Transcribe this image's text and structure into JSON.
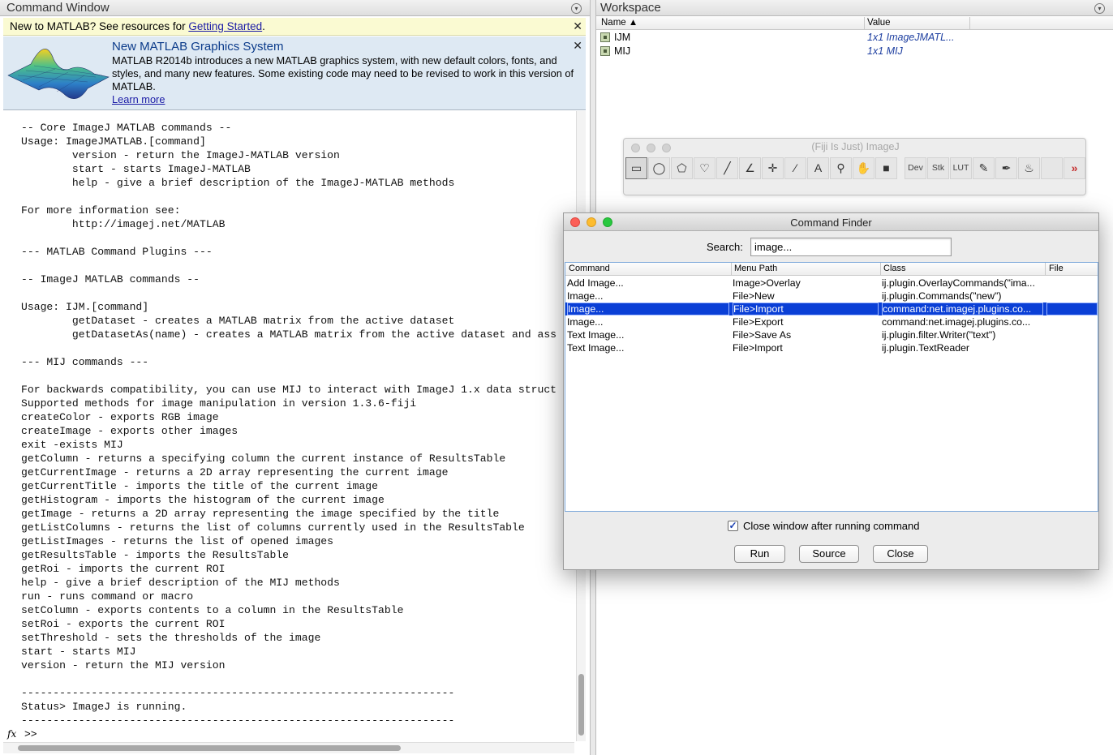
{
  "command_window": {
    "title": "Command Window",
    "new_bar": {
      "text": "New to MATLAB? See resources for ",
      "link": "Getting Started",
      "suffix": "."
    },
    "announcement": {
      "title": "New MATLAB Graphics System",
      "body": "MATLAB R2014b introduces a new MATLAB graphics system, with new default colors, fonts, and styles, and many new features.  Some existing code may need to be revised to work in this version of MATLAB.",
      "link": "Learn more"
    },
    "console_lines": [
      "-- Core ImageJ MATLAB commands --",
      "Usage: ImageJMATLAB.[command]",
      "        version - return the ImageJ-MATLAB version",
      "        start - starts ImageJ-MATLAB",
      "        help - give a brief description of the ImageJ-MATLAB methods",
      "",
      "For more information see:",
      "        http://imagej.net/MATLAB",
      "",
      "--- MATLAB Command Plugins ---",
      "",
      "-- ImageJ MATLAB commands --",
      "",
      "Usage: IJM.[command]",
      "        getDataset - creates a MATLAB matrix from the active dataset",
      "        getDatasetAs(name) - creates a MATLAB matrix from the active dataset and ass",
      "",
      "--- MIJ commands ---",
      "",
      "For backwards compatibility, you can use MIJ to interact with ImageJ 1.x data struct",
      "Supported methods for image manipulation in version 1.3.6-fiji",
      "createColor - exports RGB image",
      "createImage - exports other images",
      "exit -exists MIJ",
      "getColumn - returns a specifying column the current instance of ResultsTable",
      "getCurrentImage - returns a 2D array representing the current image",
      "getCurrentTitle - imports the title of the current image",
      "getHistogram - imports the histogram of the current image",
      "getImage - returns a 2D array representing the image specified by the title",
      "getListColumns - returns the list of columns currently used in the ResultsTable",
      "getListImages - returns the list of opened images",
      "getResultsTable - imports the ResultsTable",
      "getRoi - imports the current ROI",
      "help - give a brief description of the MIJ methods",
      "run - runs command or macro",
      "setColumn - exports contents to a column in the ResultsTable",
      "setRoi - exports the current ROI",
      "setThreshold - sets the thresholds of the image",
      "start - starts MIJ",
      "version - return the MIJ version",
      "",
      "--------------------------------------------------------------------",
      "Status> ImageJ is running.",
      "--------------------------------------------------------------------"
    ],
    "prompt_fx": "fx",
    "prompt": ">>"
  },
  "workspace": {
    "title": "Workspace",
    "columns": {
      "name": "Name ▲",
      "value": "Value"
    },
    "rows": [
      {
        "name": "IJM",
        "value": "1x1 ImageJMATL..."
      },
      {
        "name": "MIJ",
        "value": "1x1 MIJ"
      }
    ]
  },
  "imagej": {
    "title": "(Fiji Is Just) ImageJ",
    "tools": [
      {
        "name": "rectangle-tool",
        "glyph": "▭"
      },
      {
        "name": "oval-tool",
        "glyph": "◯"
      },
      {
        "name": "polygon-tool",
        "glyph": "⬠"
      },
      {
        "name": "freehand-tool",
        "glyph": "♡"
      },
      {
        "name": "line-tool",
        "glyph": "╱"
      },
      {
        "name": "angle-tool",
        "glyph": "∠"
      },
      {
        "name": "point-tool",
        "glyph": "✛"
      },
      {
        "name": "wand-tool",
        "glyph": "⁄"
      },
      {
        "name": "text-tool",
        "glyph": "A"
      },
      {
        "name": "magnifier-tool",
        "glyph": "⚲"
      },
      {
        "name": "hand-tool",
        "glyph": "✋"
      },
      {
        "name": "color-picker-tool",
        "glyph": "■"
      },
      {
        "name": "dev-tool",
        "glyph": "Dev"
      },
      {
        "name": "stk-tool",
        "glyph": "Stk"
      },
      {
        "name": "lut-tool",
        "glyph": "LUT"
      },
      {
        "name": "pencil-tool",
        "glyph": "✎"
      },
      {
        "name": "brush-tool",
        "glyph": "✒"
      },
      {
        "name": "flood-fill-tool",
        "glyph": "♨"
      },
      {
        "name": "blank-tool",
        "glyph": ""
      },
      {
        "name": "more-tools",
        "glyph": "»"
      }
    ]
  },
  "finder": {
    "title": "Command Finder",
    "search_label": "Search:",
    "search_value": "image...",
    "columns": {
      "command": "Command",
      "menu_path": "Menu Path",
      "class": "Class",
      "file": "File"
    },
    "rows": [
      {
        "command": "Add Image...",
        "menu_path": "Image>Overlay",
        "class": "ij.plugin.OverlayCommands(\"ima...",
        "file": ""
      },
      {
        "command": "Image...",
        "menu_path": "File>New",
        "class": "ij.plugin.Commands(\"new\")",
        "file": ""
      },
      {
        "command": "Image...",
        "menu_path": "File>Import",
        "class": "command:net.imagej.plugins.co...",
        "file": ""
      },
      {
        "command": "Image...",
        "menu_path": "File>Export",
        "class": "command:net.imagej.plugins.co...",
        "file": ""
      },
      {
        "command": "Text Image...",
        "menu_path": "File>Save As",
        "class": "ij.plugin.filter.Writer(\"text\")",
        "file": ""
      },
      {
        "command": "Text Image...",
        "menu_path": "File>Import",
        "class": "ij.plugin.TextReader",
        "file": ""
      }
    ],
    "selected_row": 2,
    "checkbox_label": "Close window after running command",
    "checkbox_checked": true,
    "buttons": {
      "run": "Run",
      "source": "Source",
      "close": "Close"
    }
  }
}
